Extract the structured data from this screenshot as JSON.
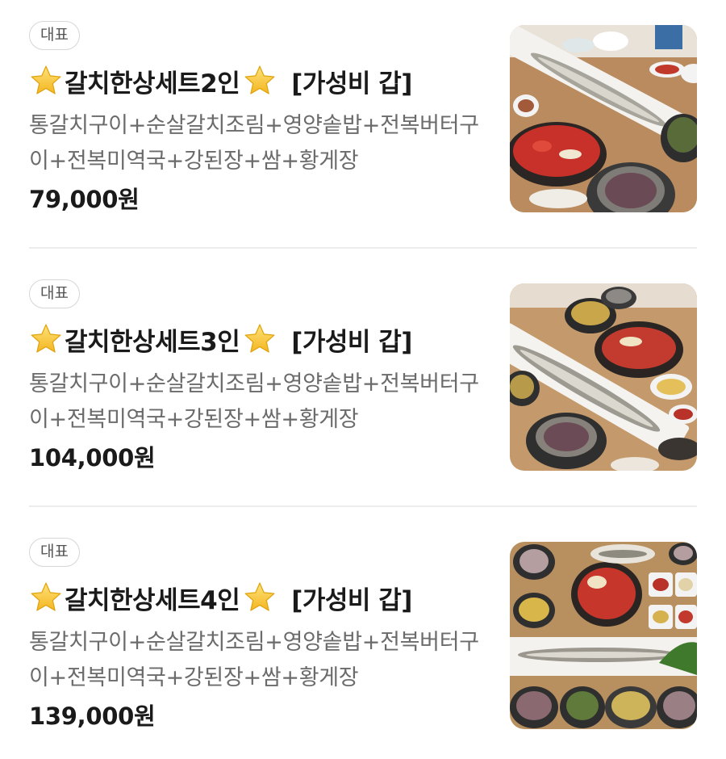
{
  "menu": {
    "items": [
      {
        "badge": "대표",
        "title": "갈치한상세트2인",
        "tag": "[가성비 갑]",
        "description": "통갈치구이+순살갈치조림+영양솥밥+전복버터구이+전복미역국+강된장+쌈+황게장",
        "price": "79,000원",
        "image_icon": "food-photo-icon"
      },
      {
        "badge": "대표",
        "title": "갈치한상세트3인",
        "tag": "[가성비 갑]",
        "description": "통갈치구이+순살갈치조림+영양솥밥+전복버터구이+전복미역국+강된장+쌈+황게장",
        "price": "104,000원",
        "image_icon": "food-photo-icon"
      },
      {
        "badge": "대표",
        "title": "갈치한상세트4인",
        "tag": "[가성비 갑]",
        "description": "통갈치구이+순살갈치조림+영양솥밥+전복버터구이+전복미역국+강된장+쌈+황게장",
        "price": "139,000원",
        "image_icon": "food-photo-icon"
      }
    ]
  },
  "colors": {
    "star": "#f7c531",
    "badge_border": "#d6d6d6",
    "description": "#6b6b6b",
    "divider": "#ececec"
  }
}
